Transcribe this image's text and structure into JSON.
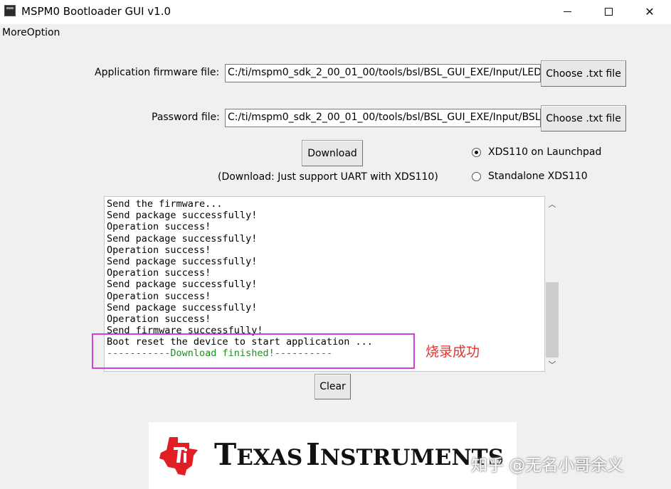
{
  "window": {
    "title": "MSPM0 Bootloader GUI  v1.0"
  },
  "menu": {
    "more_option": "MoreOption"
  },
  "firmware": {
    "label": "Application firmware file:",
    "value": "C:/ti/mspm0_sdk_2_00_01_00/tools/bsl/BSL_GUI_EXE/Input/LED",
    "choose_label": "Choose .txt file"
  },
  "password": {
    "label": "Password file:",
    "value": "C:/ti/mspm0_sdk_2_00_01_00/tools/bsl/BSL_GUI_EXE/Input/BSL",
    "choose_label": "Choose .txt file"
  },
  "download": {
    "button_label": "Download",
    "note": "(Download: Just support UART with XDS110)"
  },
  "radios": [
    {
      "label": "XDS110 on Launchpad",
      "checked": true
    },
    {
      "label": "Standalone XDS110",
      "checked": false
    }
  ],
  "log": {
    "lines": [
      "Send the firmware...",
      "Send package successfully!",
      "Operation success!",
      "Send package successfully!",
      "Operation success!",
      "Send package successfully!",
      "Operation success!",
      "Send package successfully!",
      "Operation success!",
      "Send package successfully!",
      "Operation success!",
      "Send firmware successfully!",
      "Boot reset the device to start application ...",
      "-----------Download finished!----------"
    ]
  },
  "clear_label": "Clear",
  "annotation": "烧录成功",
  "logo": {
    "company_first_initial": "T",
    "company_first_rest": "EXAS",
    "company_second_initial": "I",
    "company_second_rest": "NSTRUMENTS"
  },
  "watermark": "知乎 @无名小哥余义",
  "colors": {
    "highlight": "#d43fd4",
    "annotation": "#e53030",
    "log_green": "#1f8f1f",
    "ti_red": "#e01e24"
  }
}
